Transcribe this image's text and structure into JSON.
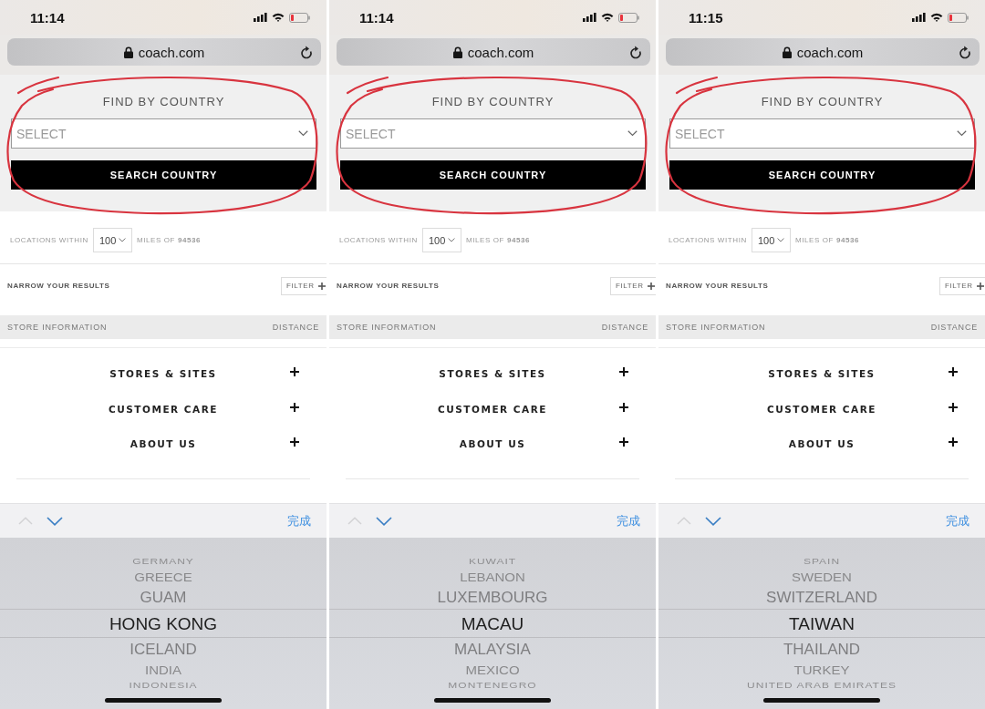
{
  "phones": [
    {
      "status_bar": {
        "time": "11:14"
      },
      "address_bar": {
        "url": "coach.com"
      },
      "country_search": {
        "heading": "FIND BY COUNTRY",
        "select": {
          "placeholder": "SELECT"
        },
        "button": "SEARCH COUNTRY",
        "circled": true
      },
      "locations": {
        "label": "LOCATIONS WITHIN",
        "radius": "100",
        "miles": "MILES OF **94536**"
      },
      "narrow": {
        "label": "NARROW YOUR RESULTS",
        "filter_button": "FILTER"
      },
      "results_header": {
        "columns": [
          "STORE INFORMATION",
          "DISTANCE"
        ]
      },
      "footer_links": [
        {
          "label": "STORES & SITES",
          "expanded": false
        },
        {
          "label": "CUSTOMER CARE",
          "expanded": false
        },
        {
          "label": "ABOUT US",
          "expanded": false
        }
      ],
      "picker_toolbar": {
        "previous_enabled": false,
        "next_enabled": true,
        "done": "完成"
      },
      "picker": {
        "options": [
          {
            "label": "GERMANY",
            "selected": false
          },
          {
            "label": "GREECE",
            "selected": false
          },
          {
            "label": "GUAM",
            "selected": false
          },
          {
            "label": "HONG KONG",
            "selected": true
          },
          {
            "label": "ICELAND",
            "selected": false
          },
          {
            "label": "INDIA",
            "selected": false
          },
          {
            "label": "INDONESIA",
            "selected": false
          }
        ]
      }
    },
    {
      "status_bar": {
        "time": "11:14"
      },
      "address_bar": {
        "url": "coach.com"
      },
      "country_search": {
        "heading": "FIND BY COUNTRY",
        "select": {
          "placeholder": "SELECT"
        },
        "button": "SEARCH COUNTRY",
        "circled": true
      },
      "locations": {
        "label": "LOCATIONS WITHIN",
        "radius": "100",
        "miles": "MILES OF **94536**"
      },
      "narrow": {
        "label": "NARROW YOUR RESULTS",
        "filter_button": "FILTER"
      },
      "results_header": {
        "columns": [
          "STORE INFORMATION",
          "DISTANCE"
        ]
      },
      "footer_links": [
        {
          "label": "STORES & SITES",
          "expanded": false
        },
        {
          "label": "CUSTOMER CARE",
          "expanded": false
        },
        {
          "label": "ABOUT US",
          "expanded": false
        }
      ],
      "picker_toolbar": {
        "previous_enabled": false,
        "next_enabled": true,
        "done": "完成"
      },
      "picker": {
        "options": [
          {
            "label": "KUWAIT",
            "selected": false
          },
          {
            "label": "LEBANON",
            "selected": false
          },
          {
            "label": "LUXEMBOURG",
            "selected": false
          },
          {
            "label": "MACAU",
            "selected": true
          },
          {
            "label": "MALAYSIA",
            "selected": false
          },
          {
            "label": "MEXICO",
            "selected": false
          },
          {
            "label": "MONTENEGRO",
            "selected": false
          }
        ]
      }
    },
    {
      "status_bar": {
        "time": "11:15"
      },
      "address_bar": {
        "url": "coach.com"
      },
      "country_search": {
        "heading": "FIND BY COUNTRY",
        "select": {
          "placeholder": "SELECT"
        },
        "button": "SEARCH COUNTRY",
        "circled": true
      },
      "locations": {
        "label": "LOCATIONS WITHIN",
        "radius": "100",
        "miles": "MILES OF **94536**"
      },
      "narrow": {
        "label": "NARROW YOUR RESULTS",
        "filter_button": "FILTER"
      },
      "results_header": {
        "columns": [
          "STORE INFORMATION",
          "DISTANCE"
        ]
      },
      "footer_links": [
        {
          "label": "STORES & SITES",
          "expanded": false
        },
        {
          "label": "CUSTOMER CARE",
          "expanded": false
        },
        {
          "label": "ABOUT US",
          "expanded": false
        }
      ],
      "picker_toolbar": {
        "previous_enabled": false,
        "next_enabled": true,
        "done": "完成"
      },
      "picker": {
        "options": [
          {
            "label": "SPAIN",
            "selected": false
          },
          {
            "label": "SWEDEN",
            "selected": false
          },
          {
            "label": "SWITZERLAND",
            "selected": false
          },
          {
            "label": "TAIWAN",
            "selected": true
          },
          {
            "label": "THAILAND",
            "selected": false
          },
          {
            "label": "TURKEY",
            "selected": false
          },
          {
            "label": "UNITED ARAB EMIRATES",
            "selected": false
          }
        ]
      }
    }
  ]
}
